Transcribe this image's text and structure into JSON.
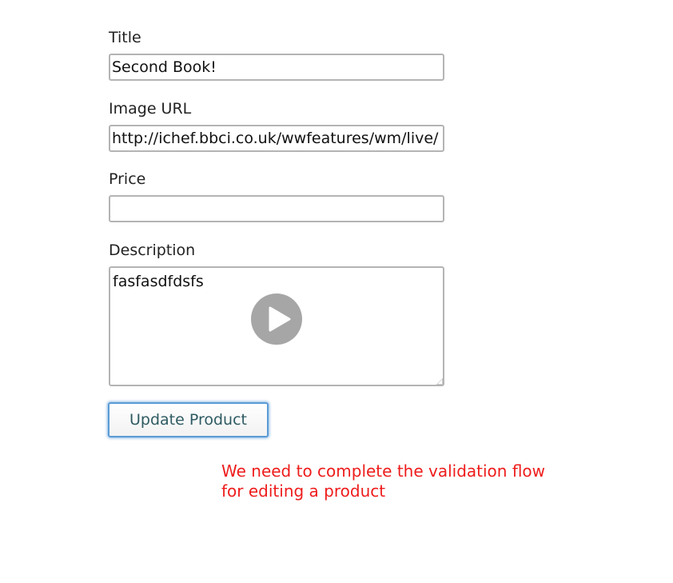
{
  "form": {
    "title": {
      "label": "Title",
      "value": "Second Book!"
    },
    "image_url": {
      "label": "Image URL",
      "value": "http://ichef.bbci.co.uk/wwfeatures/wm/live/"
    },
    "price": {
      "label": "Price",
      "value": ""
    },
    "description": {
      "label": "Description",
      "value": "fasfasdfdsfs"
    },
    "submit_label": "Update Product"
  },
  "video": {
    "play_icon": "play-icon",
    "overlay_color": "#a6a6a6"
  },
  "caption": {
    "line1": "We need to complete the validation flow",
    "line2": "for editing a product",
    "color": "#ee1c1c"
  }
}
